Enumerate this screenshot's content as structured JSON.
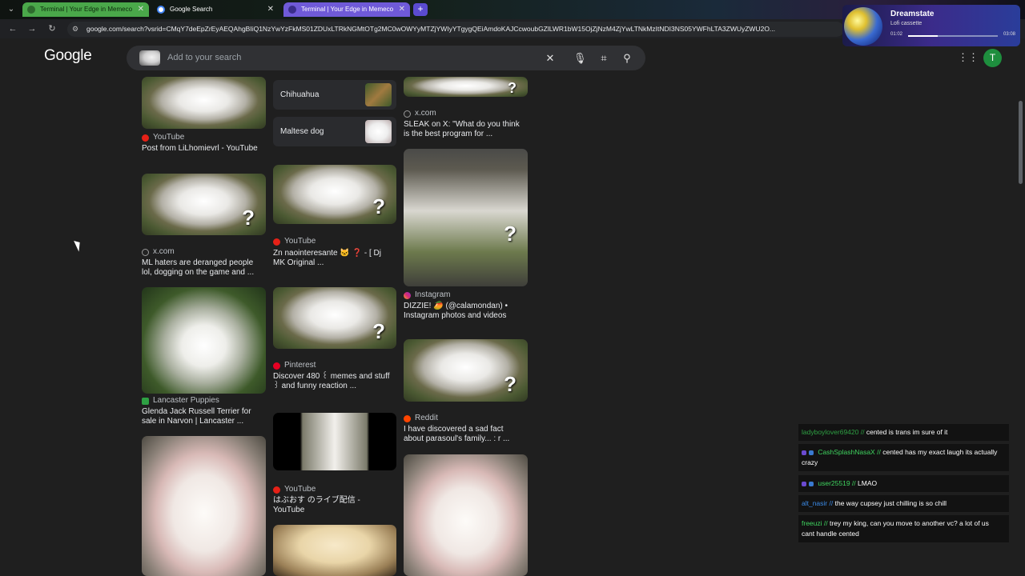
{
  "browser": {
    "tabs": [
      {
        "label": "Terminal | Your Edge in Memeco",
        "active": false
      },
      {
        "label": "Google Search",
        "active": true
      },
      {
        "label": "Terminal | Your Edge in Memeco",
        "active": false
      }
    ],
    "url": "google.com/search?vsrid=CMqY7deEpZrEyAEQAhgBIiQ1NzYwYzFkMS01ZDUxLTRkNGMtOTg2MC0wOWYyMTZjYWIyYTgygQEiAmdoKAJCcwoubGZlLWR1bW15OjZjNzM4ZjYwLTNkMzItNDI3NS05YWFhLTA3ZWUyZWU2O..."
  },
  "media": {
    "title": "Dreamstate",
    "subtitle": "Lofi cassette",
    "elapsed": "01:02",
    "total": "03:08",
    "progress": 0.33
  },
  "google": {
    "logo": "Google",
    "search_placeholder": "Add to your search",
    "avatar_letter": "T"
  },
  "results": {
    "col1": [
      {
        "source": "YouTube",
        "title": "Post from LiLhomievrl - YouTube"
      },
      {
        "source": "x.com",
        "title_l1": "ML haters are deranged people",
        "title_l2": "lol, dogging on the game and ..."
      },
      {
        "source": "Lancaster Puppies",
        "title_l1": "Glenda Jack Russell Terrier for",
        "title_l2": "sale in Narvon | Lancaster ..."
      }
    ],
    "related": [
      {
        "label": "Chihuahua"
      },
      {
        "label": "Maltese dog"
      }
    ],
    "col2": [
      {
        "source": "YouTube",
        "title_l1": "Zn naointeresante 🐱 ❓ - [ Dj",
        "title_l2": "MK Original ..."
      },
      {
        "source": "Pinterest",
        "title_l1": "Discover 480 ꒰ memes and stuff",
        "title_l2": "꒱ and funny reaction ..."
      },
      {
        "source": "YouTube",
        "title_l1": "はぶおす のライブ配信 -",
        "title_l2": "YouTube"
      }
    ],
    "col3": [
      {
        "source": "x.com",
        "title_l1": "SLEAK on X: \"What do you think",
        "title_l2": "is the best program for ..."
      },
      {
        "source": "Instagram",
        "title_l1": "DIZZIE! 🥭 (@calamondan) •",
        "title_l2": "Instagram photos and videos"
      },
      {
        "source": "Reddit",
        "title_l1": "I have discovered a sad fact",
        "title_l2": "about parasoul's family... : r ..."
      }
    ],
    "overlay_mark": "?"
  },
  "chat": [
    {
      "user": "ladyboylover69420",
      "sep": "//",
      "text": "cented is trans im sure of it",
      "color": "#2ea043"
    },
    {
      "user": "CashSplashNasaX",
      "sep": "//",
      "text": "cented has my exact laugh its actually",
      "text2": "crazy",
      "color": "#3fd45f"
    },
    {
      "user": "user25519",
      "sep": "//",
      "text": "LMAO",
      "color": "#3fd45f"
    },
    {
      "user": "alt_nasir",
      "sep": "//",
      "text": "the way cupsey just chilling is so chill",
      "color": "#3b8ae6"
    },
    {
      "user": "freeuzi",
      "sep": "//",
      "text": "trey my king, can you move to another vc? a lot of us",
      "text2": "cant handle cented",
      "color": "#3fd45f"
    }
  ]
}
